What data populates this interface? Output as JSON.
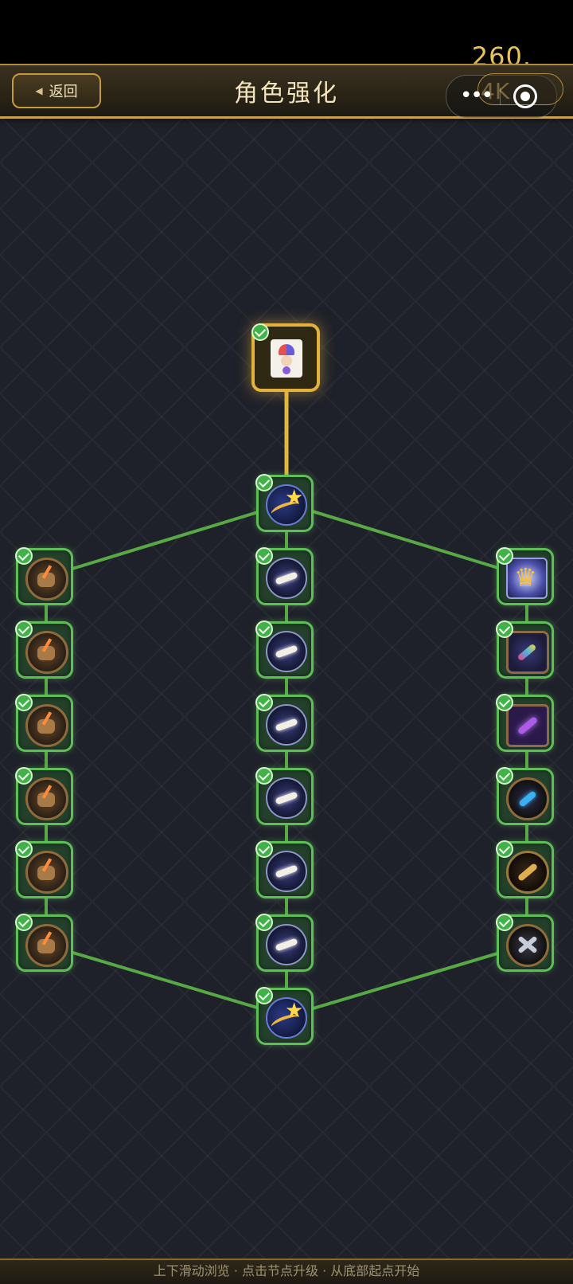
{
  "status_bar": {
    "number": "260."
  },
  "header": {
    "back_label": "返回",
    "title": "角色强化",
    "capsule_ghost_text": "4K"
  },
  "footer": {
    "hint": "上下滑动浏览 · 点击节点升级 · 从底部起点开始"
  },
  "colors": {
    "unlocked_border": "#5fbf57",
    "root_border": "#e3b13e",
    "gold_edge": "#e0b83a",
    "green_edge": "#58a845"
  },
  "tree": {
    "root": {
      "icon": "jester-card-icon",
      "unlocked": true
    },
    "nodes": [
      {
        "id": "start-top",
        "icon": "star-orb-icon",
        "unlocked": true
      },
      {
        "id": "left-1",
        "icon": "bag-icon",
        "unlocked": true
      },
      {
        "id": "left-2",
        "icon": "bag-icon",
        "unlocked": true
      },
      {
        "id": "left-3",
        "icon": "bag-icon",
        "unlocked": true
      },
      {
        "id": "left-4",
        "icon": "bag-icon",
        "unlocked": true
      },
      {
        "id": "left-5",
        "icon": "bag-icon",
        "unlocked": true
      },
      {
        "id": "left-6",
        "icon": "bag-icon",
        "unlocked": true
      },
      {
        "id": "mid-1",
        "icon": "bone-icon",
        "unlocked": true
      },
      {
        "id": "mid-2",
        "icon": "bone-icon",
        "unlocked": true
      },
      {
        "id": "mid-3",
        "icon": "bone-icon",
        "unlocked": true
      },
      {
        "id": "mid-4",
        "icon": "bone-icon",
        "unlocked": true
      },
      {
        "id": "mid-5",
        "icon": "bone-icon",
        "unlocked": true
      },
      {
        "id": "mid-6",
        "icon": "bone-icon",
        "unlocked": true
      },
      {
        "id": "right-1",
        "icon": "crown-icon",
        "unlocked": true
      },
      {
        "id": "right-2",
        "icon": "rainbow-bone-icon",
        "unlocked": true
      },
      {
        "id": "right-3",
        "icon": "purple-bone-icon",
        "unlocked": true
      },
      {
        "id": "right-4",
        "icon": "blue-bone-icon",
        "unlocked": true
      },
      {
        "id": "right-5",
        "icon": "gold-bone-icon",
        "unlocked": true
      },
      {
        "id": "right-6",
        "icon": "crossed-bones-icon",
        "unlocked": true
      },
      {
        "id": "start-bottom",
        "icon": "star-orb-icon",
        "unlocked": true
      }
    ]
  }
}
